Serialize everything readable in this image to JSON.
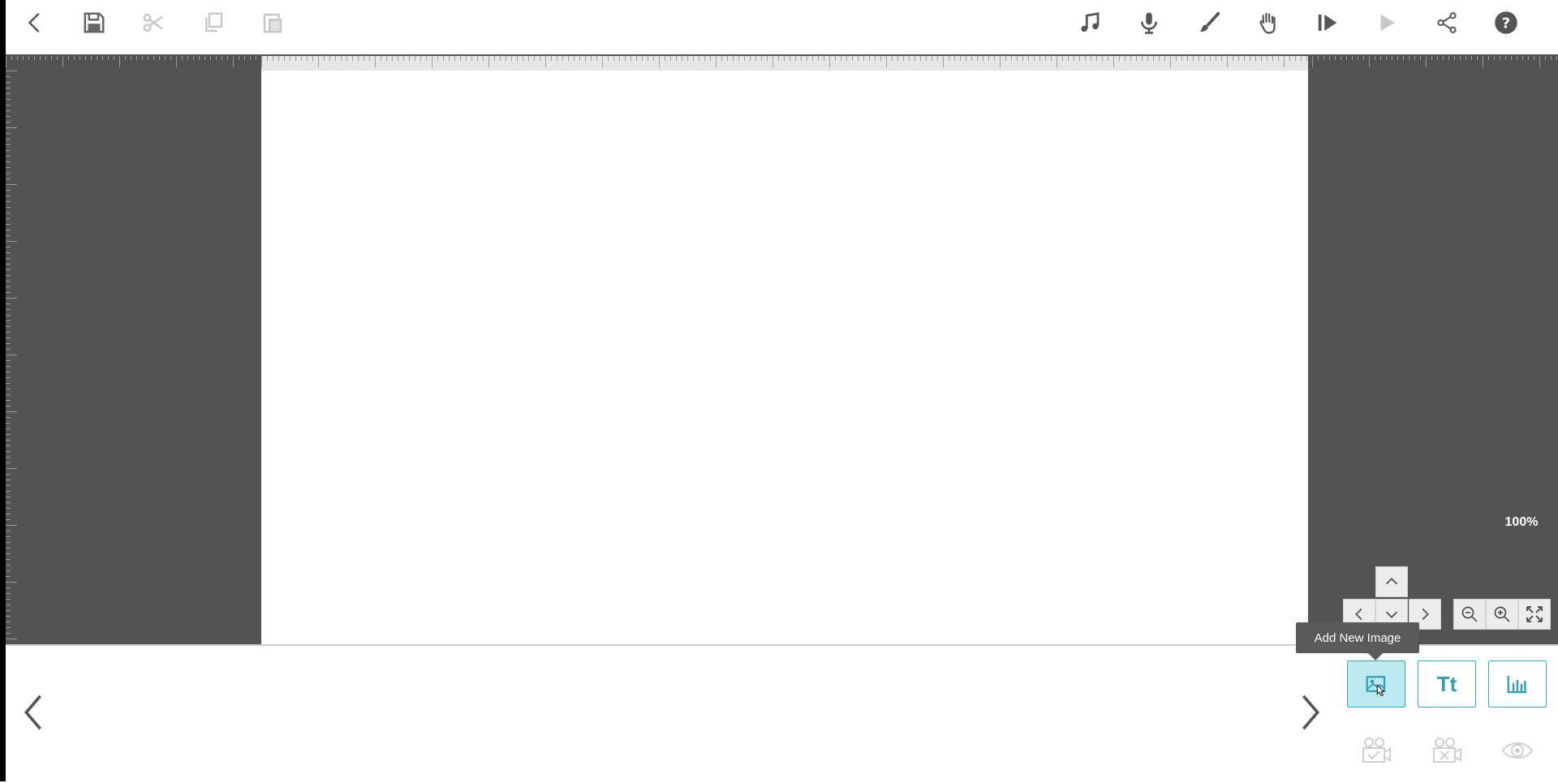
{
  "toolbar": {
    "left_icons": [
      "back-arrow-icon",
      "save-icon",
      "scissors-icon",
      "copy-icon",
      "paste-icon"
    ],
    "right_icons": [
      "music-note-icon",
      "microphone-icon",
      "paintbrush-icon",
      "hand-icon",
      "play-from-start-icon",
      "play-icon",
      "share-icon",
      "help-icon"
    ]
  },
  "zoom": {
    "level": "100%",
    "icons": [
      "zoom-out-icon",
      "zoom-in-icon",
      "fit-screen-icon"
    ]
  },
  "tooltip": {
    "text": "Add New Image"
  },
  "add_buttons": {
    "text_label": "Tt",
    "icons": [
      "add-image-icon",
      "add-text-icon",
      "add-chart-icon"
    ]
  },
  "bottom_icons": [
    "camera-check-icon",
    "camera-delete-icon",
    "eye-icon"
  ],
  "colors": {
    "workspace": "#535353",
    "accent": "#2f9fb3",
    "active_button_bg": "#bde9f1",
    "icon_gray": "#666666",
    "icon_disabled": "#c8c8c8"
  }
}
